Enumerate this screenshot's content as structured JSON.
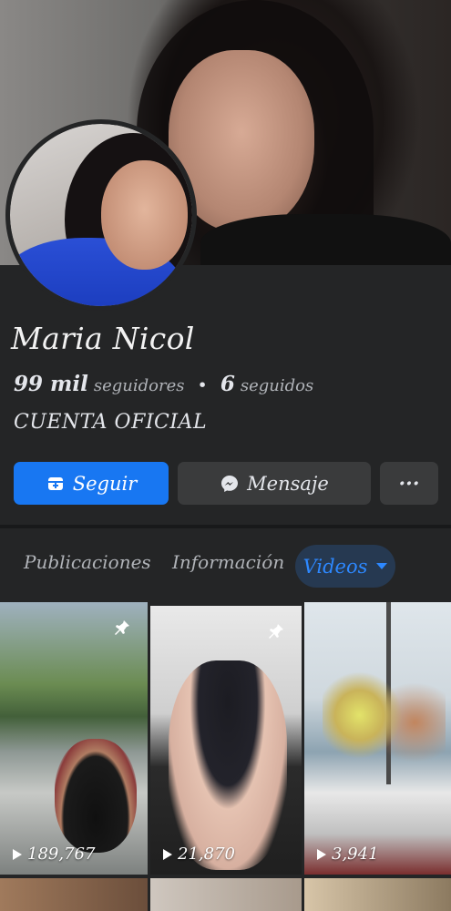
{
  "profile": {
    "name": "Maria Nicol",
    "followers_count": "99 mil",
    "followers_label": "seguidores",
    "separator": "•",
    "following_count": "6",
    "following_label": "seguidos",
    "bio": "CUENTA OFICIAL"
  },
  "actions": {
    "follow_label": "Seguir",
    "message_label": "Mensaje",
    "more_label": "···"
  },
  "tabs": {
    "publications": "Publicaciones",
    "info": "Información",
    "videos": "Videos"
  },
  "videos": [
    {
      "views": "189,767",
      "pinned": true
    },
    {
      "views": "21,870",
      "pinned": true
    },
    {
      "views": "3,941",
      "pinned": false
    }
  ],
  "colors": {
    "accent": "#1877f2",
    "tab_active_bg": "#263951",
    "tab_active_text": "#2d88ff",
    "background": "#242526"
  },
  "icons": {
    "follow": "add-friend-icon",
    "message": "messenger-icon",
    "pin": "pin-icon",
    "play": "play-icon",
    "dropdown": "chevron-down-icon"
  }
}
